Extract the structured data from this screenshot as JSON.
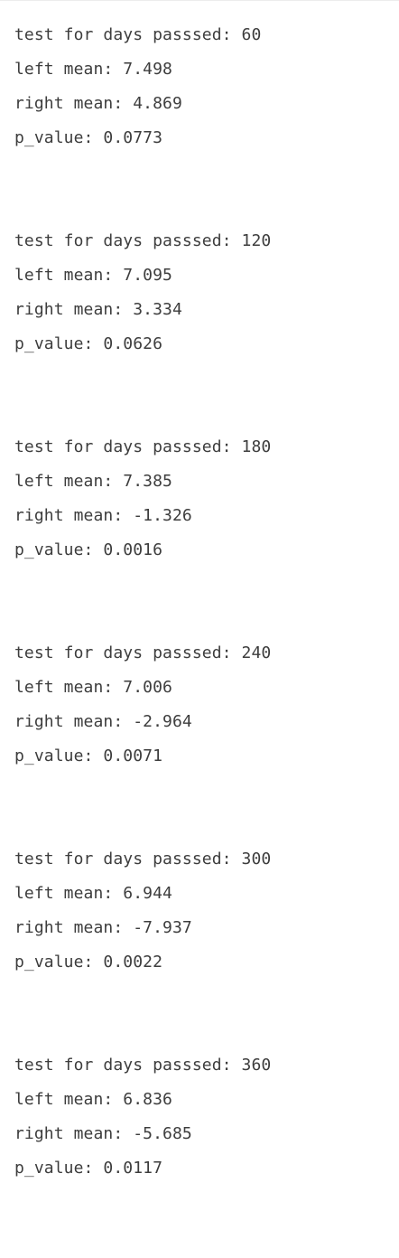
{
  "output": {
    "blocks": [
      {
        "header": "test for days passsed: 60",
        "left_mean": "left mean: 7.498",
        "right_mean": "right mean: 4.869",
        "p_value": "p_value: 0.0773"
      },
      {
        "header": "test for days passsed: 120",
        "left_mean": "left mean: 7.095",
        "right_mean": "right mean: 3.334",
        "p_value": "p_value: 0.0626"
      },
      {
        "header": "test for days passsed: 180",
        "left_mean": "left mean: 7.385",
        "right_mean": "right mean: -1.326",
        "p_value": "p_value: 0.0016"
      },
      {
        "header": "test for days passsed: 240",
        "left_mean": "left mean: 7.006",
        "right_mean": "right mean: -2.964",
        "p_value": "p_value: 0.0071"
      },
      {
        "header": "test for days passsed: 300",
        "left_mean": "left mean: 6.944",
        "right_mean": "right mean: -7.937",
        "p_value": "p_value: 0.0022"
      },
      {
        "header": "test for days passsed: 360",
        "left_mean": "left mean: 6.836",
        "right_mean": "right mean: -5.685",
        "p_value": "p_value: 0.0117"
      }
    ]
  }
}
